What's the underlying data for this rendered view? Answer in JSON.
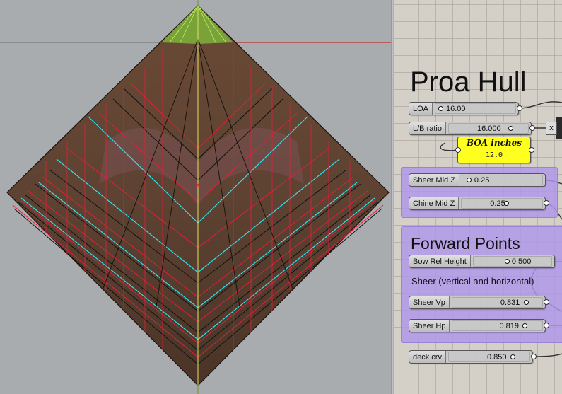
{
  "viewport": {
    "colors": {
      "background": "#a9acaf",
      "hull_fill": "#5a4030",
      "red_curve": "#e0203a",
      "cyan_curve": "#33e0f0",
      "green_tip": "#8ccf3a",
      "axis_red": "#c0302c"
    }
  },
  "canvas": {
    "title": "Proa Hull",
    "sliders": {
      "loa": {
        "label": "LOA",
        "value": "16.00"
      },
      "lb_ratio": {
        "label": "L/B ratio",
        "value": "16.000"
      },
      "sheer_mid_z": {
        "label": "Sheer Mid Z",
        "value": "0.25"
      },
      "chine_mid_z": {
        "label": "Chine Mid Z",
        "value": "0.25"
      },
      "bow_rel_height": {
        "label": "Bow Rel Height",
        "value": "0.500"
      },
      "sheer_vp": {
        "label": "Sheer Vp",
        "value": "0.831"
      },
      "sheer_hp": {
        "label": "Sheer Hp",
        "value": "0.819"
      },
      "deck_crv": {
        "label": "deck crv",
        "value": "0.850"
      }
    },
    "boa_panel": {
      "title": "BOA inches",
      "value": "12.0"
    },
    "multiply_label": "x",
    "forward_group": {
      "title": "Forward Points",
      "subtitle": "Sheer (vertical and horizontal)"
    },
    "colors": {
      "group_fill": "#b096ec",
      "panel_yellow": "#ffff1f",
      "canvas_bg": "#d4d0c8"
    }
  }
}
